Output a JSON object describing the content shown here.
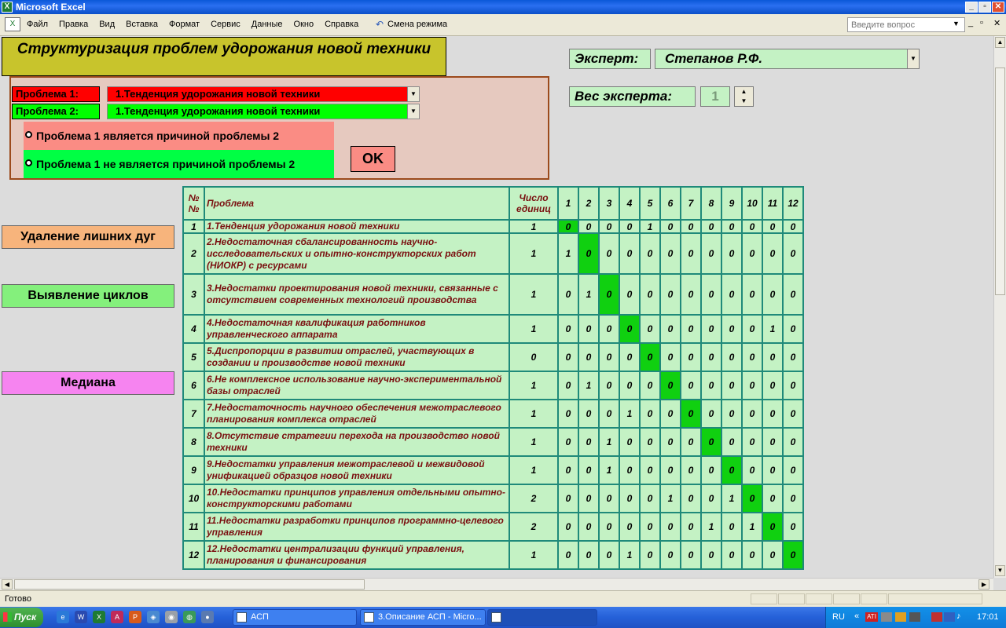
{
  "window": {
    "title": "Microsoft Excel",
    "min": "_",
    "max": "▫",
    "close": "✕"
  },
  "menu": {
    "items": [
      "Файл",
      "Правка",
      "Вид",
      "Вставка",
      "Формат",
      "Сервис",
      "Данные",
      "Окно",
      "Справка"
    ],
    "mode": "Смена режима",
    "question_placeholder": "Введите вопрос"
  },
  "sheet": {
    "title": "Структуризация проблем удорожания новой техники",
    "problem1_label": "Проблема 1:",
    "problem1_value": "1.Тенденция удорожания новой техники",
    "problem2_label": "Проблема 2:",
    "problem2_value": "1.Тенденция удорожания новой техники",
    "radio_cause": "Проблема 1 является причиной проблемы 2",
    "radio_not_cause": "Проблема 1 не является причиной проблемы 2",
    "ok": "OK",
    "expert_label": "Эксперт:",
    "expert_value": "Степанов Р.Ф.",
    "weight_label": "Вес эксперта:",
    "weight_value": "1",
    "btn_remove": "Удаление лишних дуг",
    "btn_cycles": "Выявление циклов",
    "btn_median": "Медиана",
    "colors": {
      "red": "#ff0000",
      "green": "#00ff00",
      "diag": "#10d010"
    }
  },
  "table": {
    "h_num": "№ №",
    "h_problem": "Проблема",
    "h_count": "Число единиц",
    "cols": [
      "1",
      "2",
      "3",
      "4",
      "5",
      "6",
      "7",
      "8",
      "9",
      "10",
      "11",
      "12"
    ],
    "rows": [
      {
        "n": "1",
        "name": "1.Тенденция удорожания новой техники",
        "count": "1",
        "vals": [
          "0",
          "0",
          "0",
          "0",
          "1",
          "0",
          "0",
          "0",
          "0",
          "0",
          "0",
          "0"
        ]
      },
      {
        "n": "2",
        "name": "2.Недостаточная сбалансированность научно-исследовательских и опытно-конструкторских работ (НИОКР) с ресурсами",
        "count": "1",
        "vals": [
          "1",
          "0",
          "0",
          "0",
          "0",
          "0",
          "0",
          "0",
          "0",
          "0",
          "0",
          "0"
        ]
      },
      {
        "n": "3",
        "name": "3.Недостатки проектирования новой техники, связанные с отсутствием современных технологий производства",
        "count": "1",
        "vals": [
          "0",
          "1",
          "0",
          "0",
          "0",
          "0",
          "0",
          "0",
          "0",
          "0",
          "0",
          "0"
        ]
      },
      {
        "n": "4",
        "name": "4.Недостаточная квалификация работников управленческого аппарата",
        "count": "1",
        "vals": [
          "0",
          "0",
          "0",
          "0",
          "0",
          "0",
          "0",
          "0",
          "0",
          "0",
          "1",
          "0"
        ]
      },
      {
        "n": "5",
        "name": "5.Диспропорции в развитии отраслей, участвующих в создании и производстве новой техники",
        "count": "0",
        "vals": [
          "0",
          "0",
          "0",
          "0",
          "0",
          "0",
          "0",
          "0",
          "0",
          "0",
          "0",
          "0"
        ]
      },
      {
        "n": "6",
        "name": "6.Не комплексное использование научно-экспериментальной базы отраслей",
        "count": "1",
        "vals": [
          "0",
          "1",
          "0",
          "0",
          "0",
          "0",
          "0",
          "0",
          "0",
          "0",
          "0",
          "0"
        ]
      },
      {
        "n": "7",
        "name": "7.Недостаточность научного обеспечения межотраслевого планирования комплекса отраслей",
        "count": "1",
        "vals": [
          "0",
          "0",
          "0",
          "1",
          "0",
          "0",
          "0",
          "0",
          "0",
          "0",
          "0",
          "0"
        ]
      },
      {
        "n": "8",
        "name": "8.Отсутствие стратегии перехода на производство новой техники",
        "count": "1",
        "vals": [
          "0",
          "0",
          "1",
          "0",
          "0",
          "0",
          "0",
          "0",
          "0",
          "0",
          "0",
          "0"
        ]
      },
      {
        "n": "9",
        "name": "9.Недостатки управления межотраслевой и межвидовой унификацией образцов новой техники",
        "count": "1",
        "vals": [
          "0",
          "0",
          "1",
          "0",
          "0",
          "0",
          "0",
          "0",
          "0",
          "0",
          "0",
          "0"
        ]
      },
      {
        "n": "10",
        "name": "10.Недостатки принципов управления отдельными опытно-конструкторскими работами",
        "count": "2",
        "vals": [
          "0",
          "0",
          "0",
          "0",
          "0",
          "1",
          "0",
          "0",
          "1",
          "0",
          "0",
          "0"
        ]
      },
      {
        "n": "11",
        "name": "11.Недостатки разработки принципов программно-целевого управления",
        "count": "2",
        "vals": [
          "0",
          "0",
          "0",
          "0",
          "0",
          "0",
          "0",
          "1",
          "0",
          "1",
          "0",
          "0"
        ]
      },
      {
        "n": "12",
        "name": "12.Недостатки централизации функций управления, планирования и финансирования",
        "count": "1",
        "vals": [
          "0",
          "0",
          "0",
          "1",
          "0",
          "0",
          "0",
          "0",
          "0",
          "0",
          "0",
          "0"
        ]
      }
    ]
  },
  "status": {
    "text": "Готово"
  },
  "taskbar": {
    "start": "Пуск",
    "tasks": [
      "АСП",
      "3.Описание АСП - Micro..."
    ],
    "lang": "RU",
    "time": "17:01"
  }
}
